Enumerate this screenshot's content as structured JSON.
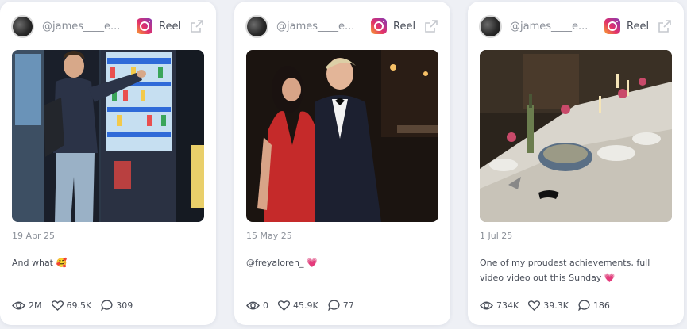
{
  "posts": [
    {
      "username": "@james____e...",
      "platform": "Reel",
      "date": "19 Apr 25",
      "caption": "And what",
      "caption_emoji": "🥰",
      "stats": {
        "views": "2M",
        "likes": "69.5K",
        "comments": "309"
      }
    },
    {
      "username": "@james____e...",
      "platform": "Reel",
      "date": "15 May 25",
      "caption": "@freyaloren_",
      "caption_emoji": "💗",
      "stats": {
        "views": "0",
        "likes": "45.9K",
        "comments": "77"
      }
    },
    {
      "username": "@james____e...",
      "platform": "Reel",
      "date": "1 Jul 25",
      "caption": "One of my proudest achievements, full video video out this Sunday",
      "caption_emoji": "💗",
      "stats": {
        "views": "734K",
        "likes": "39.3K",
        "comments": "186"
      }
    }
  ],
  "icons": {
    "avatar": "avatar",
    "platform": "instagram-icon",
    "external": "external-link-icon",
    "views": "eye-icon",
    "likes": "heart-icon",
    "comments": "comment-icon"
  }
}
